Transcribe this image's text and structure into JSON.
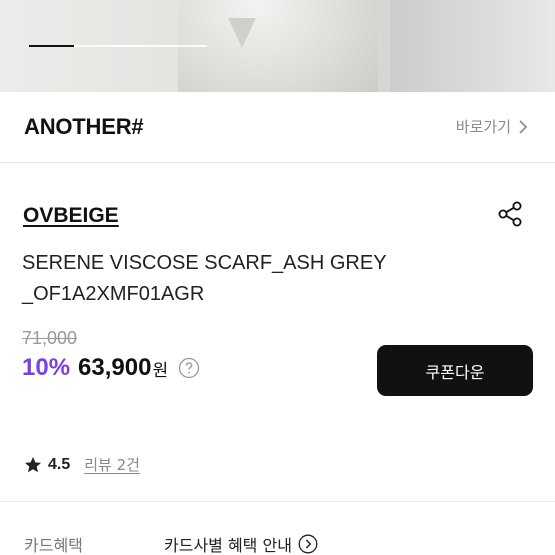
{
  "hero": {
    "carousel_progress": 0.25
  },
  "shop": {
    "logo": "ANOTHER#",
    "link_label": "바로가기"
  },
  "product": {
    "brand": "OVBEIGE",
    "name_line1": "SERENE VISCOSE SCARF_ASH GREY",
    "name_line2": "_OF1A2XMF01AGR"
  },
  "price": {
    "original": "71,000",
    "discount": "10%",
    "sale": "63,900",
    "currency": "원",
    "coupon_button": "쿠폰다운"
  },
  "rating": {
    "score": "4.5",
    "reviews": "리뷰 2건"
  },
  "card": {
    "label": "카드혜택",
    "link": "카드사별 혜택 안내"
  },
  "colors": {
    "accent": "#7b3fe4",
    "button": "#111111",
    "muted": "#999999"
  },
  "icons": [
    "chevron-right-icon",
    "share-icon",
    "question-circle-icon",
    "star-icon",
    "chevron-circle-right-icon"
  ]
}
